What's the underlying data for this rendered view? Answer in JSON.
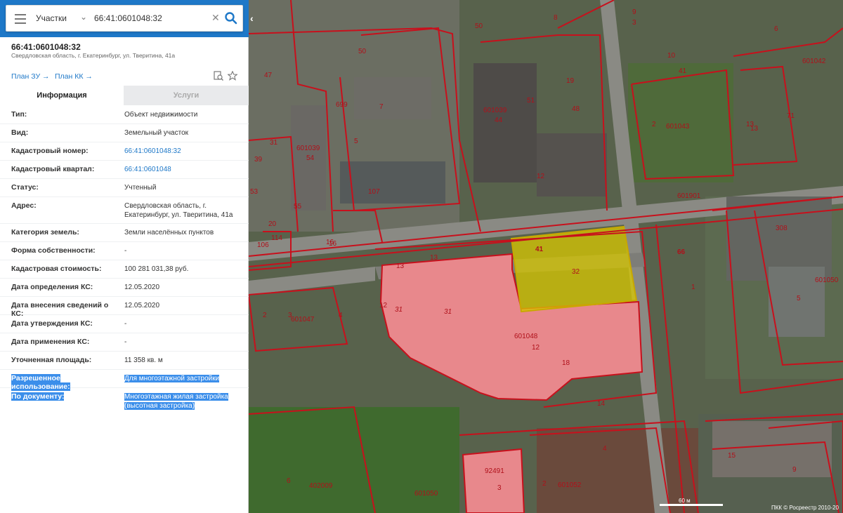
{
  "search": {
    "layer_select": "Участки",
    "query": "66:41:0601048:32"
  },
  "object": {
    "number": "66:41:0601048:32",
    "address_short": "Свердловская область, г. Екатеринбург, ул. Тверитина, 41а"
  },
  "links": {
    "plan_zu": "План ЗУ",
    "plan_kk": "План КК"
  },
  "tabs": [
    {
      "label": "Информация",
      "active": true
    },
    {
      "label": "Услуги",
      "active": false
    }
  ],
  "info_rows": [
    {
      "key": "Тип:",
      "value": "Объект недвижимости"
    },
    {
      "key": "Вид:",
      "value": "Земельный участок"
    },
    {
      "key": "Кадастровый номер:",
      "value": "66:41:0601048:32"
    },
    {
      "key": "Кадастровый квартал:",
      "value": "66:41:0601048"
    },
    {
      "key": "Статус:",
      "value": "Учтенный"
    },
    {
      "key": "Адрес:",
      "value": "Свердловская область, г. Екатеринбург, ул. Тверитина, 41а"
    },
    {
      "key": "Категория земель:",
      "value": "Земли населённых пунктов"
    },
    {
      "key": "Форма собственности:",
      "value": "-"
    },
    {
      "key": "Кадастровая стоимость:",
      "value": "100 281 031,38 руб."
    },
    {
      "key": "Дата определения КС:",
      "value": "12.05.2020"
    },
    {
      "key": "Дата внесения сведений о КС:",
      "value": "12.05.2020"
    },
    {
      "key": "Дата утверждения КС:",
      "value": "-"
    },
    {
      "key": "Дата применения КС:",
      "value": "-"
    },
    {
      "key": "Уточненная площадь:",
      "value": "11 358 кв. м"
    },
    {
      "key": "Разрешенное использование:",
      "value": "Для многоэтажной застройки"
    },
    {
      "key": "По документу:",
      "value": "Многоэтажная жилая застройка (высотная застройка)"
    }
  ],
  "map": {
    "scale": "60 м",
    "copyright": "ПКК © Росреестр 2010-20",
    "labels": [
      "601048",
      "12",
      "18",
      "31",
      "31",
      "41",
      "32",
      "66",
      "601039",
      "601039",
      "601043",
      "601042",
      "601050",
      "601047",
      "601052",
      "601050",
      "601901",
      "402009",
      "92491",
      "107",
      "7",
      "50",
      "50",
      "5",
      "3",
      "9",
      "6",
      "10",
      "41",
      "71",
      "13",
      "2",
      "1",
      "5",
      "308",
      "19",
      "48",
      "51",
      "44",
      "699",
      "47",
      "39",
      "53",
      "55",
      "54",
      "114",
      "20",
      "106",
      "16",
      "13",
      "13",
      "12",
      "14",
      "15",
      "4",
      "2",
      "3",
      "6",
      "2",
      "3",
      "4",
      "12",
      "13",
      "16",
      "31",
      "9",
      "8"
    ],
    "colors": {
      "pink": "#e8888c",
      "yellow": "#d8c800",
      "border": "#c8101c"
    }
  }
}
